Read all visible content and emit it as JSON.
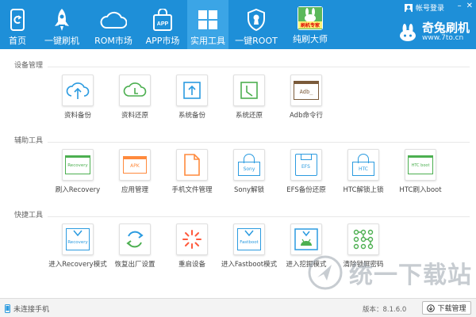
{
  "nav": {
    "items": [
      {
        "label": "首页",
        "icon": "phone-refresh-icon"
      },
      {
        "label": "一键刷机",
        "icon": "rocket-icon"
      },
      {
        "label": "ROM市场",
        "icon": "cloud-icon"
      },
      {
        "label": "APP市场",
        "icon": "app-bag-icon"
      },
      {
        "label": "实用工具",
        "icon": "grid-icon"
      },
      {
        "label": "一键ROOT",
        "icon": "shield-icon"
      },
      {
        "label": "纯刷大师",
        "icon": "rabbit-expert-icon"
      }
    ],
    "active": "实用工具",
    "expert_badge": "刷机专家"
  },
  "header": {
    "login_label": "帐号登录",
    "brand_name": "奇兔刷机",
    "brand_url": "www.7to.cn"
  },
  "sections": [
    {
      "title": "设备管理",
      "tools": [
        {
          "label": "资料备份",
          "icon": "cloud-upload-icon"
        },
        {
          "label": "资料还原",
          "icon": "cloud-download-icon"
        },
        {
          "label": "系统备份",
          "icon": "system-backup-icon"
        },
        {
          "label": "系统还原",
          "icon": "system-restore-icon"
        },
        {
          "label": "Adb命令行",
          "icon": "adb-terminal-icon",
          "icon_text": "Adb_"
        }
      ]
    },
    {
      "title": "辅助工具",
      "tools": [
        {
          "label": "刷入Recovery",
          "icon": "recovery-folder-icon",
          "icon_text": "Recovery"
        },
        {
          "label": "应用管理",
          "icon": "apk-tray-icon",
          "icon_text": "APK"
        },
        {
          "label": "手机文件管理",
          "icon": "file-icon"
        },
        {
          "label": "Sony解锁",
          "icon": "sony-lock-icon",
          "icon_text": "Sony"
        },
        {
          "label": "EFS备份还原",
          "icon": "efs-disk-icon",
          "icon_text": "EFS"
        },
        {
          "label": "HTC解锁上锁",
          "icon": "htc-lock-icon",
          "icon_text": "HTC"
        },
        {
          "label": "HTC刷入boot",
          "icon": "htc-boot-folder-icon",
          "icon_text": "HTC boot"
        }
      ]
    },
    {
      "title": "快捷工具",
      "tools": [
        {
          "label": "进入Recovery模式",
          "icon": "recovery-mode-icon",
          "icon_text": "Recovery"
        },
        {
          "label": "恢复出厂设置",
          "icon": "factory-reset-icon"
        },
        {
          "label": "重启设备",
          "icon": "reboot-icon"
        },
        {
          "label": "进入Fastboot模式",
          "icon": "fastboot-mode-icon",
          "icon_text": "Fastboot"
        },
        {
          "label": "进入挖掘模式",
          "icon": "android-mode-icon"
        },
        {
          "label": "清除锁屏密码",
          "icon": "pattern-lock-icon"
        }
      ]
    }
  ],
  "status": {
    "device_status": "未连接手机",
    "version": "版本：8.1.6.0",
    "download_label": "下载管理"
  },
  "watermark": {
    "text": "统一下载站"
  },
  "colors": {
    "header_bg": "#1e8fd8",
    "header_active": "#3ba5e6",
    "icon_blue": "#2b9be0",
    "icon_green": "#4caf50",
    "icon_orange": "#ff8a3d",
    "icon_brown": "#7a5a3a"
  }
}
